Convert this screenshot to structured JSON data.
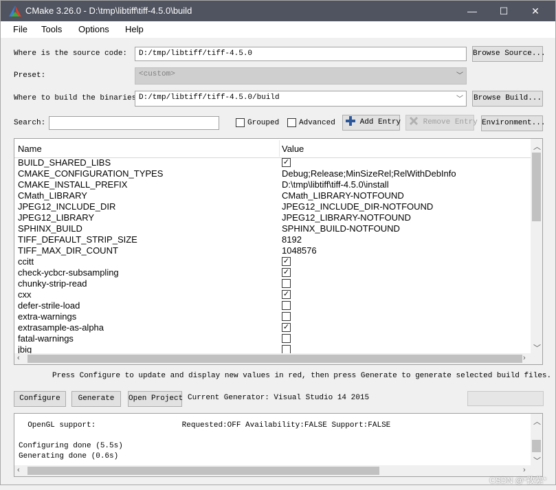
{
  "window": {
    "title": "CMake 3.26.0 - D:\\tmp\\libtiff\\tiff-4.5.0\\build",
    "minimize": "—",
    "maximize": "☐",
    "close": "✕"
  },
  "menu": {
    "file": "File",
    "tools": "Tools",
    "options": "Options",
    "help": "Help"
  },
  "source": {
    "label": "Where is the source code:",
    "value": "D:/tmp/libtiff/tiff-4.5.0",
    "browse": "Browse Source..."
  },
  "preset": {
    "label": "Preset:",
    "value": "<custom>"
  },
  "build": {
    "label": "Where to build the binaries:",
    "value": "D:/tmp/libtiff/tiff-4.5.0/build",
    "browse": "Browse Build..."
  },
  "search": {
    "label": "Search:",
    "value": "",
    "grouped": "Grouped",
    "advanced": "Advanced",
    "add_entry": "Add Entry",
    "remove_entry": "Remove Entry",
    "environment": "Environment..."
  },
  "table": {
    "col_name": "Name",
    "col_value": "Value",
    "rows": [
      {
        "name": "BUILD_SHARED_LIBS",
        "value": "",
        "checked": true,
        "bool": true
      },
      {
        "name": "CMAKE_CONFIGURATION_TYPES",
        "value": "Debug;Release;MinSizeRel;RelWithDebInfo",
        "bool": false
      },
      {
        "name": "CMAKE_INSTALL_PREFIX",
        "value": "D:\\tmp\\libtiff\\tiff-4.5.0\\install",
        "bool": false
      },
      {
        "name": "CMath_LIBRARY",
        "value": "CMath_LIBRARY-NOTFOUND",
        "bool": false
      },
      {
        "name": "JPEG12_INCLUDE_DIR",
        "value": "JPEG12_INCLUDE_DIR-NOTFOUND",
        "bool": false
      },
      {
        "name": "JPEG12_LIBRARY",
        "value": "JPEG12_LIBRARY-NOTFOUND",
        "bool": false
      },
      {
        "name": "SPHINX_BUILD",
        "value": "SPHINX_BUILD-NOTFOUND",
        "bool": false
      },
      {
        "name": "TIFF_DEFAULT_STRIP_SIZE",
        "value": "8192",
        "bool": false
      },
      {
        "name": "TIFF_MAX_DIR_COUNT",
        "value": "1048576",
        "bool": false
      },
      {
        "name": "ccitt",
        "value": "",
        "checked": true,
        "bool": true
      },
      {
        "name": "check-ycbcr-subsampling",
        "value": "",
        "checked": true,
        "bool": true
      },
      {
        "name": "chunky-strip-read",
        "value": "",
        "checked": false,
        "bool": true
      },
      {
        "name": "cxx",
        "value": "",
        "checked": true,
        "bool": true
      },
      {
        "name": "defer-strile-load",
        "value": "",
        "checked": false,
        "bool": true
      },
      {
        "name": "extra-warnings",
        "value": "",
        "checked": false,
        "bool": true
      },
      {
        "name": "extrasample-as-alpha",
        "value": "",
        "checked": true,
        "bool": true
      },
      {
        "name": "fatal-warnings",
        "value": "",
        "checked": false,
        "bool": true
      },
      {
        "name": "jbig",
        "value": "",
        "checked": false,
        "bool": true
      }
    ]
  },
  "hint": "Press Configure to update and display new values in red, then press Generate to generate selected build files.",
  "actions": {
    "configure": "Configure",
    "generate": "Generate",
    "open_project": "Open Project",
    "generator": "Current Generator: Visual Studio 14 2015"
  },
  "output": {
    "lines": [
      "  OpenGL support:                   Requested:OFF Availability:FALSE Support:FALSE",
      "",
      "Configuring done (5.5s)",
      "Generating done (0.6s)"
    ]
  },
  "watermark": "CSDN @*孜紫*",
  "colors": {
    "titlebar": "#505460",
    "accent": "#2b579a"
  }
}
